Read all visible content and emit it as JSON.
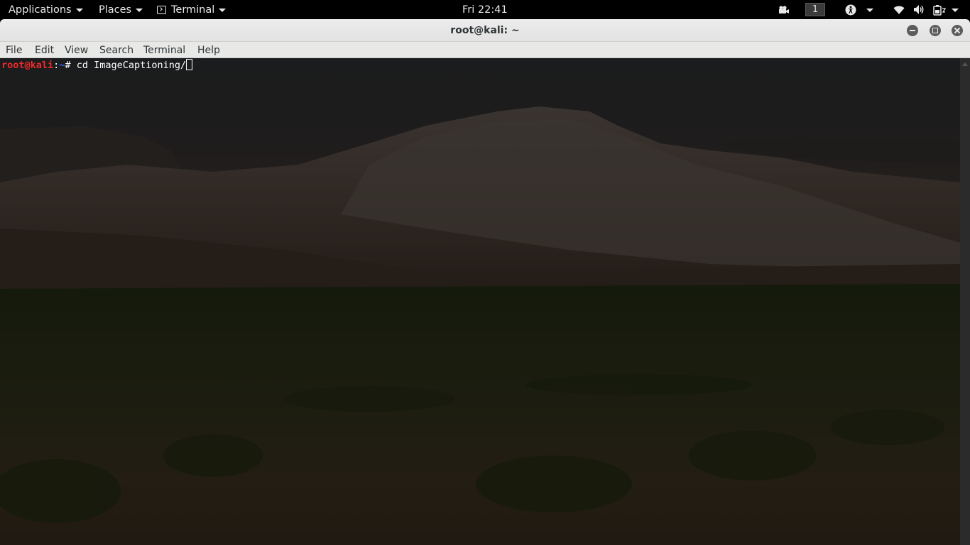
{
  "top_panel": {
    "applications_label": "Applications",
    "places_label": "Places",
    "terminal_label": "Terminal",
    "clock": "Fri 22:41",
    "workspace_number": "1",
    "icons": [
      "video-camera-icon",
      "accessibility-icon",
      "wifi-icon",
      "volume-icon",
      "battery-icon"
    ]
  },
  "window": {
    "title": "root@kali: ~",
    "controls": [
      "minimize",
      "maximize",
      "close"
    ]
  },
  "menubar": {
    "items": [
      "File",
      "Edit",
      "View",
      "Search",
      "Terminal",
      "Help"
    ]
  },
  "terminal": {
    "prompt_user": "root@kali",
    "prompt_sep": ":",
    "prompt_path": "~",
    "prompt_symbol": "# ",
    "command": "cd ImageCaptioning/"
  },
  "colors": {
    "panel_bg": "#000000",
    "prompt_user": "#ef2929",
    "prompt_path": "#3465ff",
    "text": "#ffffff",
    "titlebar": "#e8e8e8"
  }
}
